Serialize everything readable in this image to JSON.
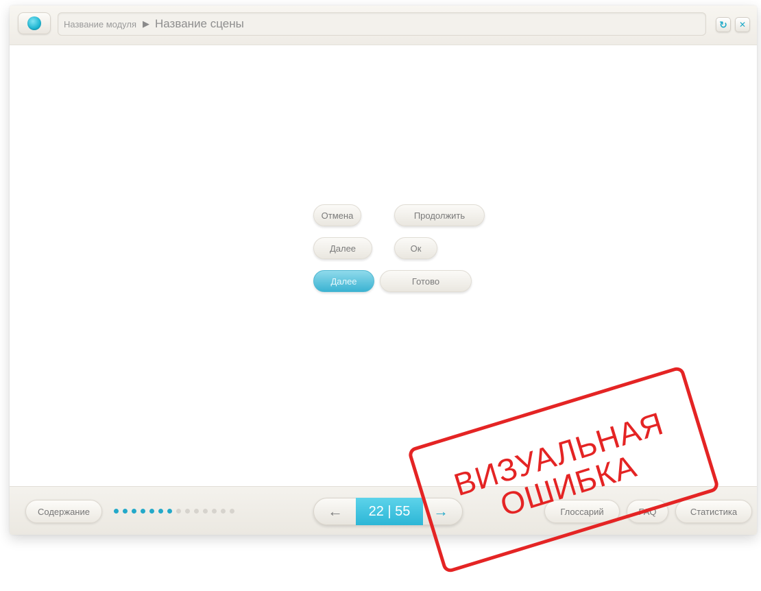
{
  "header": {
    "module_name": "Название модуля",
    "separator": "▶",
    "scene_name": "Название сцены",
    "refresh_icon": "refresh-icon",
    "close_icon": "close-icon"
  },
  "demo_buttons": {
    "cancel": "Отмена",
    "continue": "Продолжить",
    "next_default": "Далее",
    "ok": "Ок",
    "next_active": "Далее",
    "done": "Готово"
  },
  "footer": {
    "contents_label": "Содержание",
    "progress_dots_total": 14,
    "progress_dots_completed": 7,
    "prev_arrow": "←",
    "page_counter": "22 | 55",
    "next_arrow": "→",
    "glossary_label": "Глоссарий",
    "faq_label": "FAQ",
    "statistics_label": "Статистика"
  },
  "stamp": {
    "line1": "ВИЗУАЛЬНАЯ",
    "line2": "ОШИБКА"
  },
  "colors": {
    "accent": "#23a9c9",
    "stamp": "#e42424"
  }
}
